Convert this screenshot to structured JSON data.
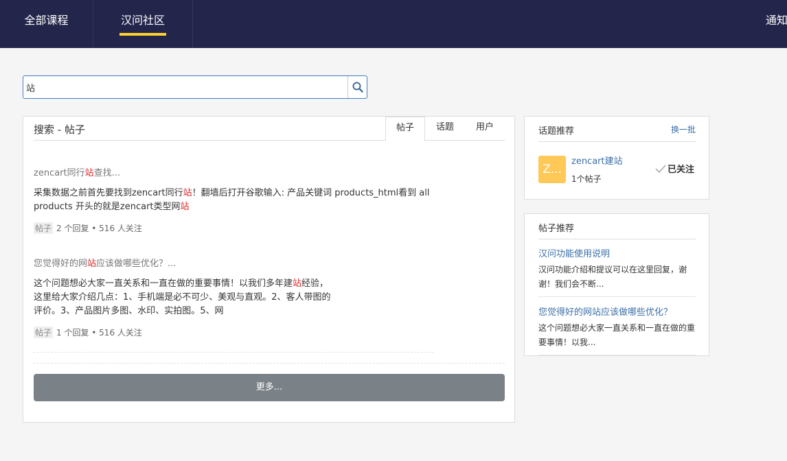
{
  "nav": {
    "items": [
      {
        "label": "全部课程"
      },
      {
        "label": "汉问社区"
      },
      {
        "label": "通知"
      }
    ]
  },
  "search": {
    "value": "站",
    "icon": "search-icon"
  },
  "main": {
    "title": "搜索 - 帖子",
    "tabs": [
      {
        "label": "帖子",
        "active": true
      },
      {
        "label": "话题",
        "active": false
      },
      {
        "label": "用户",
        "active": false
      }
    ],
    "posts": [
      {
        "title_pre": "zencart同行",
        "title_hl": "站",
        "title_post": "查找...",
        "body_1": "采集数据之前首先要找到zencart同行",
        "body_hl1": "站",
        "body_2": "！翻墙后打开谷歌输入: 产品关键词 products_html看到 all products 开头的就是zencart类型网",
        "body_hl2": "站",
        "body_3": "",
        "tag": "帖子",
        "meta": "2 个回复 • 516 人关注"
      },
      {
        "title_pre": "您觉得好的网",
        "title_hl": "站",
        "title_post": "应该做哪些优化？...",
        "body_1": "这个问题想必大家一直关系和一直在做的重要事情！以我们多年建",
        "body_hl1": "站",
        "body_2": "经验，",
        "body_line2": "这里给大家介绍几点：1、手机端是必不可少、美观与直观。2、客人带图的",
        "body_line3": "评价。3、产品图片多图、水印、实拍图。5、网",
        "tag": "帖子",
        "meta": "1 个回复 • 516 人关注"
      }
    ],
    "more_label": "更多..."
  },
  "topics": {
    "title": "话题推荐",
    "refresh_label": "换一批",
    "item": {
      "thumb": "Z...",
      "name": "zencart建站",
      "count": "1个帖子",
      "follow_label": "已关注"
    }
  },
  "recommended": {
    "title": "帖子推荐",
    "items": [
      {
        "title": "汉问功能使用说明",
        "desc": "汉问功能介绍和提议可以在这里回复，谢谢！我们会不断..."
      },
      {
        "title": "您觉得好的网站应该做哪些优化？",
        "desc": "这个问题想必大家一直关系和一直在做的重要事情！以我..."
      }
    ]
  },
  "colors": {
    "nav_bg": "#23254b",
    "accent": "#ffd233",
    "link": "#3b6fa8",
    "highlight": "#e02020",
    "button": "#7b8287"
  }
}
